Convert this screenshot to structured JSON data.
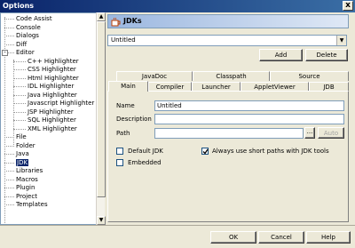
{
  "window": {
    "title": "Options",
    "close_glyph": "x"
  },
  "tree": {
    "items": [
      "Code Assist",
      "Console",
      "Dialogs",
      "Diff",
      "Editor",
      "C++ Highlighter",
      "CSS Highlighter",
      "Html Highlighter",
      "IDL Highlighter",
      "Java Highlighter",
      "Javascript Highlighter",
      "JSP Highlighter",
      "SQL Highlighter",
      "XML Highlighter",
      "File",
      "Folder",
      "Java",
      "JDK",
      "Libraries",
      "Macros",
      "Plugin",
      "Project",
      "Templates"
    ],
    "selected": "JDK",
    "editor_expander": "-"
  },
  "header": {
    "title": "JDKs",
    "icon": "jdk-cup-icon"
  },
  "jdk_select": {
    "value": "Untitled"
  },
  "buttons": {
    "add": "Add",
    "delete": "Delete",
    "auto": "Auto",
    "browse": "...",
    "ok": "OK",
    "cancel": "Cancel",
    "help": "Help"
  },
  "tabs": {
    "row1": [
      "JavaDoc",
      "Classpath",
      "Source"
    ],
    "row2": [
      "Main",
      "Compiler",
      "Launcher",
      "AppletViewer",
      "JDB"
    ],
    "active": "Main"
  },
  "main_tab": {
    "name_label": "Name",
    "name_value": "Untitled",
    "description_label": "Description",
    "description_value": "",
    "path_label": "Path",
    "path_value": "",
    "default_jdk_label": "Default JDK",
    "default_jdk_checked": false,
    "embedded_label": "Embedded",
    "embedded_checked": false,
    "short_paths_label": "Always use short paths with JDK tools",
    "short_paths_checked": true
  },
  "colors": {
    "selection": "#0a246a",
    "title_bar": "#0a246a",
    "face": "#ece9d8"
  }
}
